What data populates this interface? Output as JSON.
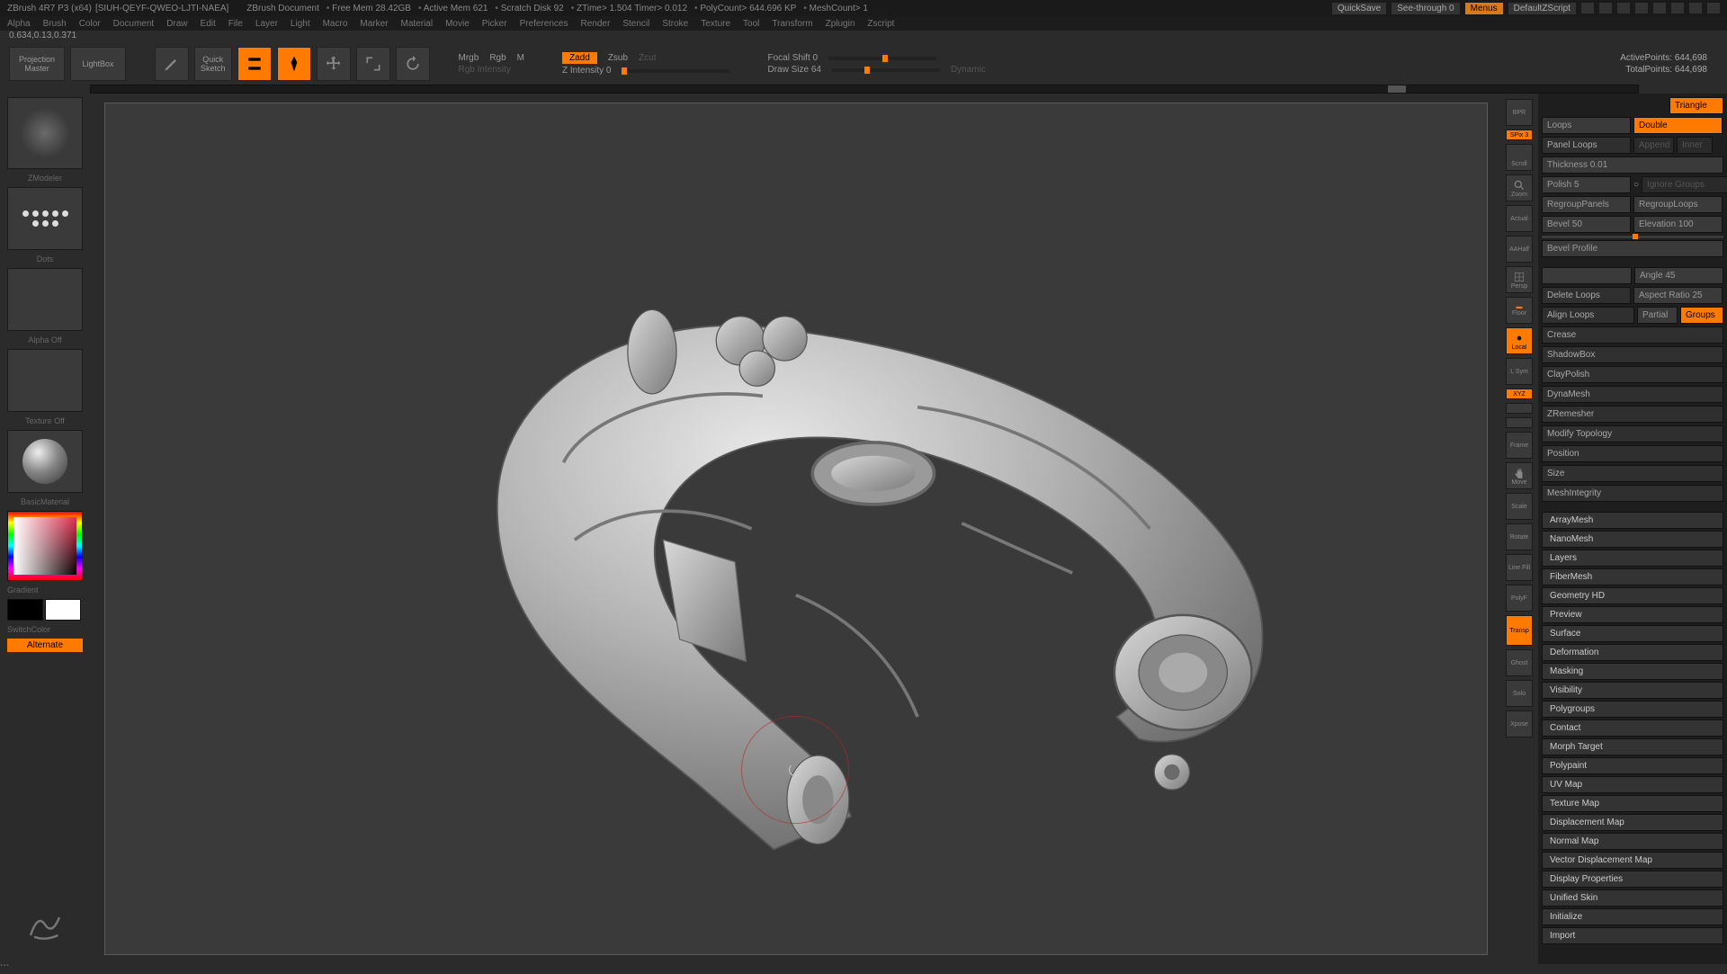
{
  "titlebar": {
    "app": "ZBrush 4R7 P3  (x64)",
    "doc": "[SIUH-QEYF-QWEO-LJTI-NAEA]",
    "docname": "ZBrush Document",
    "stats": {
      "freemem": "Free Mem 28.42GB",
      "activemem": "Active Mem 621",
      "scratch": "Scratch Disk 92",
      "ztime": "ZTime> 1.504 Timer> 0.012",
      "polycount": "PolyCount> 644.696 KP",
      "meshcount": "MeshCount> 1"
    },
    "quicksave": "QuickSave",
    "seethrough": "See-through    0",
    "menus": "Menus",
    "script": "DefaultZScript"
  },
  "menubar": [
    "Alpha",
    "Brush",
    "Color",
    "Document",
    "Draw",
    "Edit",
    "File",
    "Layer",
    "Light",
    "Macro",
    "Marker",
    "Material",
    "Movie",
    "Picker",
    "Preferences",
    "Render",
    "Stencil",
    "Stroke",
    "Texture",
    "Tool",
    "Transform",
    "Zplugin",
    "Zscript"
  ],
  "coords": "0.634,0.13,0.371",
  "toptool": {
    "projection": "Projection\nMaster",
    "lightbox": "LightBox",
    "quicksketch": "Quick\nSketch",
    "edit": "Edit",
    "draw": "Draw",
    "move": "Move",
    "scale": "Scale",
    "rotate": "Rotate",
    "mrgb": "Mrgb",
    "rgb": "Rgb",
    "m": "M",
    "rgbint": "Rgb Intensity",
    "zadd": "Zadd",
    "zsub": "Zsub",
    "zcut": "Zcut",
    "zint": "Z Intensity 0",
    "focal": "Focal Shift 0",
    "drawsize": "Draw Size 64",
    "dynamic": "Dynamic",
    "active": "ActivePoints: 644,698",
    "total": "TotalPoints: 644,698"
  },
  "left": {
    "zmodeler": "ZModeler",
    "dots": "Dots",
    "alpha": "Alpha  Off",
    "texture": "Texture  Off",
    "material": "BasicMaterial",
    "gradient": "Gradient",
    "switch": "SwitchColor",
    "alternate": "Alternate"
  },
  "rightshelf": [
    "BPR",
    "SPix 3",
    "Scroll",
    "Zoom",
    "Actual",
    "AAHalf",
    "Persp",
    "Floor",
    "Local",
    "L Sym",
    "XYZ",
    "",
    "",
    "Frame",
    "Move",
    "Scale",
    "Rotate",
    "Line Fill",
    "PolyF",
    "Transp",
    "Ghost",
    "Solo",
    "Xpose"
  ],
  "panel": {
    "panelloops": "Panel Loops",
    "loops": "Loops",
    "double": "Double",
    "append": "Append",
    "inner": "Inner",
    "thickness": "Thickness 0.01",
    "polish": "Polish 5",
    "ignoregroups": "Ignore Groups",
    "regroup1": "RegroupPanels",
    "regroup2": "RegroupLoops",
    "bevel": "Bevel 50",
    "elevation": "Elevation 100",
    "bevelprof": "Bevel Profile",
    "triangle": "Triangle",
    "angle": "Angle 45",
    "deleteloops": "Delete Loops",
    "aspect": "Aspect Ratio 25",
    "alignloops": "Align Loops",
    "partial": "Partial",
    "groups": "Groups",
    "items": [
      "Crease",
      "ShadowBox",
      "ClayPolish",
      "DynaMesh",
      "ZRemesher",
      "Modify Topology",
      "Position",
      "Size",
      "MeshIntegrity"
    ],
    "sections": [
      "ArrayMesh",
      "NanoMesh",
      "Layers",
      "FiberMesh",
      "Geometry HD",
      "Preview",
      "Surface",
      "Deformation",
      "Masking",
      "Visibility",
      "Polygroups",
      "Contact",
      "Morph Target",
      "Polypaint",
      "UV Map",
      "Texture Map",
      "Displacement Map",
      "Normal Map",
      "Vector Displacement Map",
      "Display Properties",
      "Unified Skin",
      "Initialize",
      "Import"
    ]
  }
}
